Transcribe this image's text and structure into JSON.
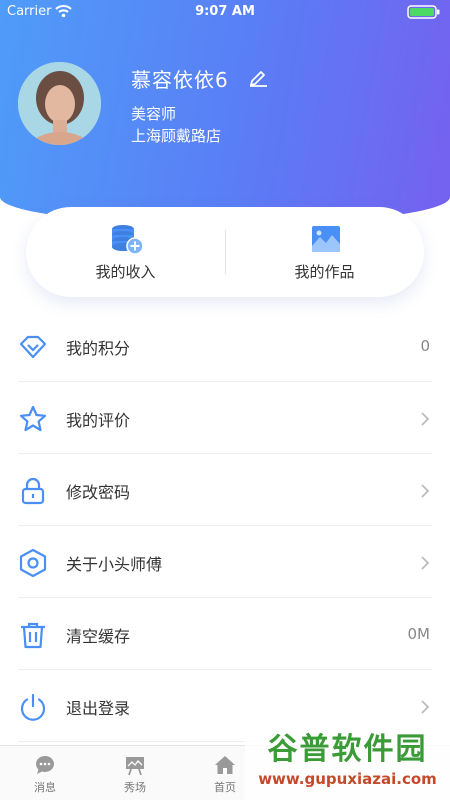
{
  "status_bar": {
    "carrier": "Carrier",
    "time": "9:07 AM"
  },
  "profile": {
    "name": "慕容依依6",
    "role": "美容师",
    "store": "上海顾戴路店"
  },
  "quick_actions": [
    {
      "label": "我的收入",
      "icon": "coins-plus-icon"
    },
    {
      "label": "我的作品",
      "icon": "picture-icon"
    }
  ],
  "menu": [
    {
      "label": "我的积分",
      "value": "0",
      "icon": "diamond-icon"
    },
    {
      "label": "我的评价",
      "value": "",
      "icon": "star-icon"
    },
    {
      "label": "修改密码",
      "value": "",
      "icon": "lock-icon"
    },
    {
      "label": "关于小头师傅",
      "value": "",
      "icon": "hexagon-icon"
    },
    {
      "label": "清空缓存",
      "value": "0M",
      "icon": "trash-icon"
    },
    {
      "label": "退出登录",
      "value": "",
      "icon": "power-icon"
    }
  ],
  "tabbar": [
    {
      "label": "消息",
      "icon": "chat-bubble-icon"
    },
    {
      "label": "秀场",
      "icon": "easel-icon"
    },
    {
      "label": "首页",
      "icon": "home-icon"
    }
  ],
  "watermark": {
    "title": "谷普软件园",
    "url": "www.gupuxiazai.com"
  },
  "colors": {
    "accent": "#4a8ff5",
    "gradient_start": "#4f9cf9",
    "gradient_end": "#7561f0"
  }
}
